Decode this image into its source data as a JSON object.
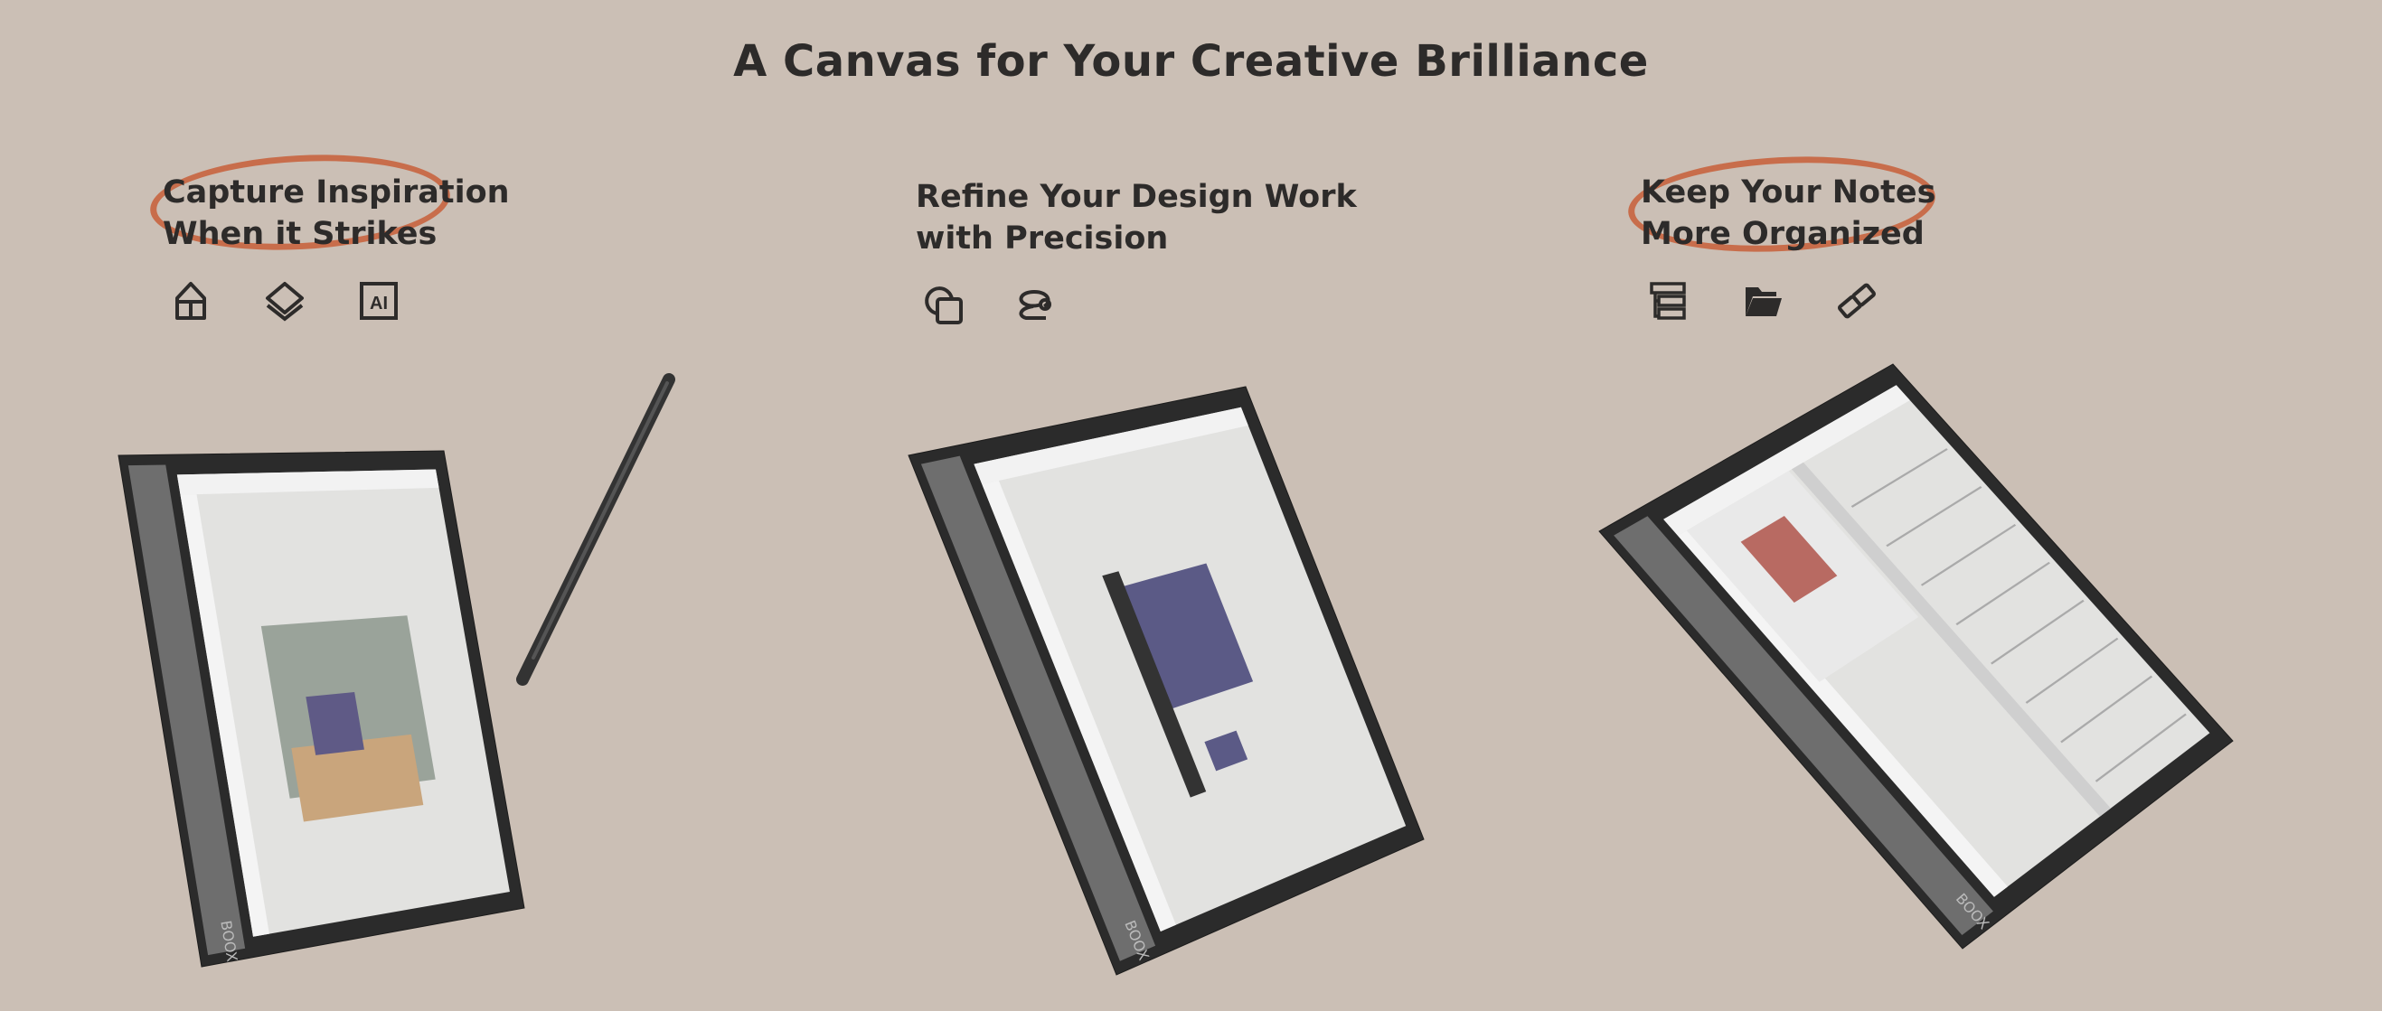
{
  "title": "A Canvas for Your Creative Brilliance",
  "features": [
    {
      "line1": "Capture Inspiration",
      "line2": "When it Strikes",
      "highlighted": true,
      "icons": [
        "home-split-icon",
        "layers-icon",
        "ai-icon"
      ],
      "ai_label": "AI"
    },
    {
      "line1": "Refine Your Design Work",
      "line2": "with Precision",
      "highlighted": false,
      "icons": [
        "shapes-icon",
        "lasso-icon"
      ]
    },
    {
      "line1": "Keep Your Notes",
      "line2": "More Organized",
      "highlighted": true,
      "icons": [
        "outline-list-icon",
        "folder-icon",
        "link-icon"
      ]
    }
  ],
  "brand": "BOOX",
  "colors": {
    "background": "#cbbfb5",
    "text": "#2d2b2a",
    "highlight": "#c8643f",
    "bezel": "#2b2b2b",
    "screen": "#e2e2e0"
  }
}
